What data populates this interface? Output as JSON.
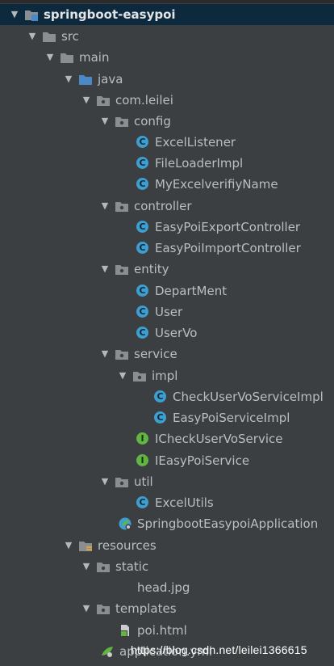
{
  "tree": {
    "project": "springboot-easypoi",
    "src": "src",
    "main": "main",
    "java": "java",
    "package": "com.leilei",
    "config": "config",
    "config_items": [
      "ExcelListener",
      "FileLoaderImpl",
      "MyExcelverifiyName"
    ],
    "controller": "controller",
    "controller_items": [
      "EasyPoiExportController",
      "EasyPoiImportController"
    ],
    "entity": "entity",
    "entity_items": [
      "DepartMent",
      "User",
      "UserVo"
    ],
    "service": "service",
    "impl": "impl",
    "impl_items": [
      "CheckUserVoServiceImpl",
      "EasyPoiServiceImpl"
    ],
    "service_items": [
      "ICheckUserVoService",
      "IEasyPoiService"
    ],
    "util": "util",
    "util_items": [
      "ExcelUtils"
    ],
    "app": "SpringbootEasypoiApplication",
    "resources": "resources",
    "static": "static",
    "static_items": [
      "head.jpg"
    ],
    "templates": "templates",
    "templates_items": [
      "poi.html"
    ],
    "app_yml": "application.yml"
  },
  "icons": {
    "class_letter": "C",
    "interface_letter": "I"
  },
  "watermark": "https://blog.csdn.net/leilei1366615",
  "colors": {
    "background": "#3c3f41",
    "selection": "#0d293e",
    "class_icon": "#3f9ed0",
    "interface_icon": "#62b543",
    "folder": "#8a8e91",
    "source_folder": "#4a88c7"
  }
}
